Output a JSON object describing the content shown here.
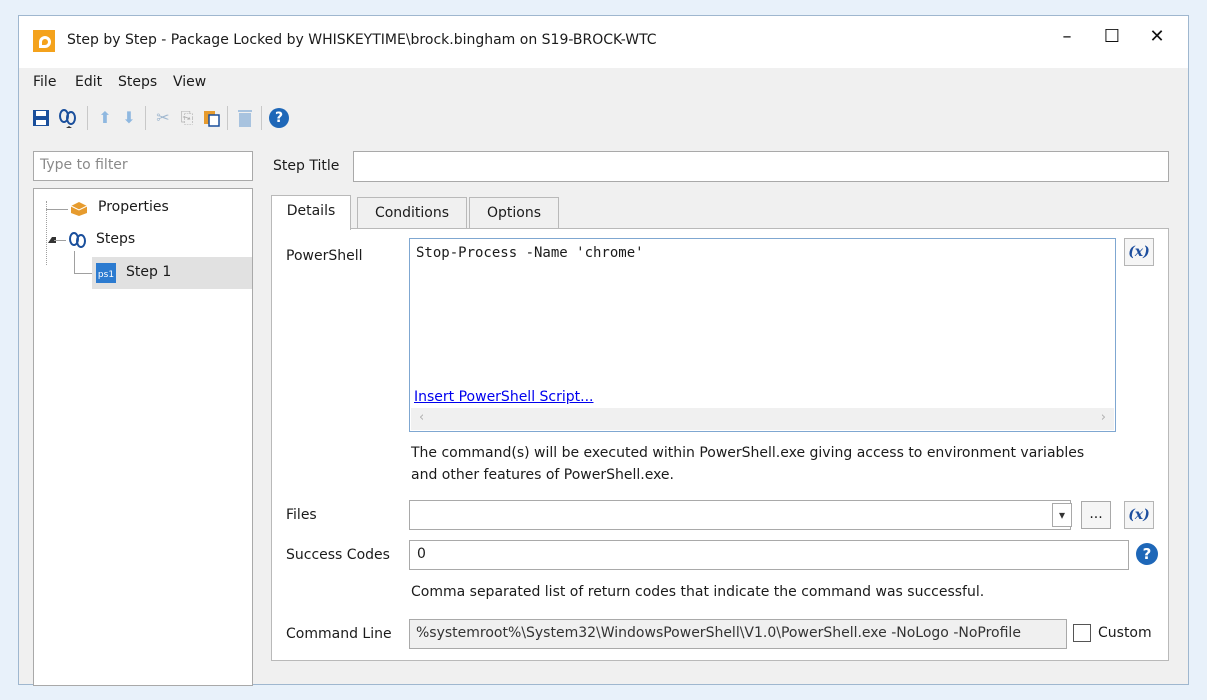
{
  "window": {
    "title": "Step by Step - Package Locked by WHISKEYTIME\\brock.bingham on S19-BROCK-WTC",
    "minimize": "–",
    "maximize": "☐",
    "close": "✕"
  },
  "menu": [
    "File",
    "Edit",
    "Steps",
    "View"
  ],
  "toolbar": {
    "icons": [
      "save-icon",
      "steps-add-icon",
      "move-up-icon",
      "move-down-icon",
      "cut-icon",
      "copy-icon",
      "paste-icon",
      "delete-icon",
      "help-icon"
    ],
    "save": "🖫",
    "add": "ಔ",
    "up": "⬆",
    "down": "⬇",
    "cut": "✂",
    "copy": "⎘",
    "paste": "📋",
    "delete": "🗑",
    "help": "?"
  },
  "filter": {
    "placeholder": "Type to filter"
  },
  "tree": {
    "properties": "Properties",
    "steps": "Steps",
    "step1": "Step 1",
    "step_icon": "ps1"
  },
  "step_title": {
    "label": "Step Title",
    "value": ""
  },
  "tabs": [
    "Details",
    "Conditions",
    "Options"
  ],
  "details": {
    "powershell_label": "PowerShell",
    "code": "Stop-Process -Name 'chrome'",
    "insert_link": "Insert PowerShell Script...",
    "fx": "(x)",
    "description": "The command(s) will be executed within PowerShell.exe giving access to environment variables and other features of PowerShell.exe.",
    "files_label": "Files",
    "files_value": "",
    "browse": "...",
    "success_codes_label": "Success Codes",
    "success_codes_value": "0",
    "success_codes_desc": "Comma separated list of return codes that indicate the command was successful.",
    "command_line_label": "Command Line",
    "command_line_value": "%systemroot%\\System32\\WindowsPowerShell\\V1.0\\PowerShell.exe -NoLogo -NoProfile",
    "custom_label": "Custom",
    "custom_checked": false
  }
}
